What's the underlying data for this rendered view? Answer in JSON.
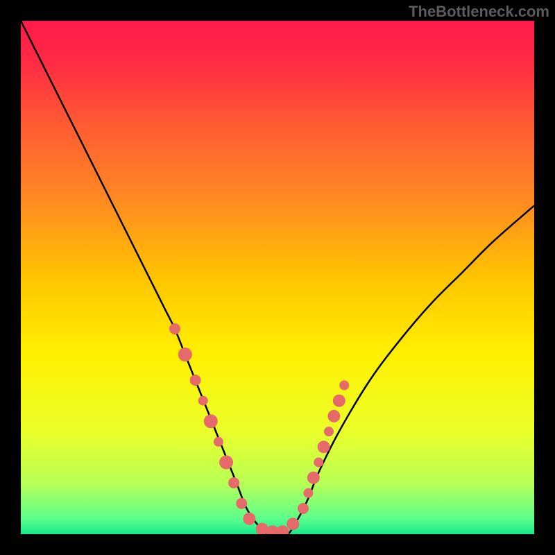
{
  "watermark": "TheBottleneck.com",
  "chart_data": {
    "type": "line",
    "title": "",
    "xlabel": "",
    "ylabel": "",
    "xlim": [
      0,
      100
    ],
    "ylim": [
      0,
      100
    ],
    "grid": false,
    "legend": false,
    "series": [
      {
        "name": "curve",
        "x": [
          0,
          4,
          8,
          12,
          16,
          20,
          24,
          28,
          30,
          32,
          34,
          36,
          38,
          40,
          42,
          44,
          46,
          48,
          50,
          52,
          54,
          56,
          58,
          62,
          68,
          74,
          80,
          86,
          92,
          100
        ],
        "y": [
          100,
          92,
          84,
          76,
          68,
          60,
          52,
          44,
          40,
          35,
          30,
          25,
          20,
          15,
          10,
          5,
          2,
          0,
          0,
          0,
          3,
          7,
          12,
          20,
          30,
          38,
          45,
          51,
          57,
          64
        ]
      }
    ],
    "markers": [
      {
        "x": 30,
        "y": 40,
        "r": 8
      },
      {
        "x": 32,
        "y": 35,
        "r": 10
      },
      {
        "x": 34,
        "y": 30,
        "r": 8
      },
      {
        "x": 35.5,
        "y": 26,
        "r": 7
      },
      {
        "x": 37,
        "y": 22,
        "r": 10
      },
      {
        "x": 38.5,
        "y": 18,
        "r": 7
      },
      {
        "x": 40,
        "y": 14,
        "r": 10
      },
      {
        "x": 41.5,
        "y": 10,
        "r": 8
      },
      {
        "x": 43,
        "y": 6,
        "r": 8
      },
      {
        "x": 44.5,
        "y": 3,
        "r": 9
      },
      {
        "x": 47,
        "y": 1,
        "r": 9
      },
      {
        "x": 49,
        "y": 0.5,
        "r": 9
      },
      {
        "x": 51,
        "y": 0.5,
        "r": 9
      },
      {
        "x": 53,
        "y": 2,
        "r": 9
      },
      {
        "x": 55,
        "y": 5,
        "r": 8
      },
      {
        "x": 56,
        "y": 8,
        "r": 7
      },
      {
        "x": 57,
        "y": 11,
        "r": 9
      },
      {
        "x": 58,
        "y": 14,
        "r": 7
      },
      {
        "x": 59,
        "y": 17,
        "r": 9
      },
      {
        "x": 60,
        "y": 20,
        "r": 7
      },
      {
        "x": 61,
        "y": 23,
        "r": 9
      },
      {
        "x": 62,
        "y": 26,
        "r": 9
      },
      {
        "x": 63,
        "y": 29,
        "r": 7
      }
    ],
    "gradient_stops": [
      {
        "offset": 0.0,
        "color": "#ff1a4b"
      },
      {
        "offset": 0.08,
        "color": "#ff2a44"
      },
      {
        "offset": 0.2,
        "color": "#ff5a33"
      },
      {
        "offset": 0.35,
        "color": "#ff8a22"
      },
      {
        "offset": 0.5,
        "color": "#ffc400"
      },
      {
        "offset": 0.65,
        "color": "#fff000"
      },
      {
        "offset": 0.8,
        "color": "#eaff2a"
      },
      {
        "offset": 0.9,
        "color": "#b8ff55"
      },
      {
        "offset": 0.97,
        "color": "#5cff8c"
      },
      {
        "offset": 1.0,
        "color": "#17e88a"
      }
    ],
    "marker_color": "#e66a6a",
    "curve_color": "#000000"
  }
}
